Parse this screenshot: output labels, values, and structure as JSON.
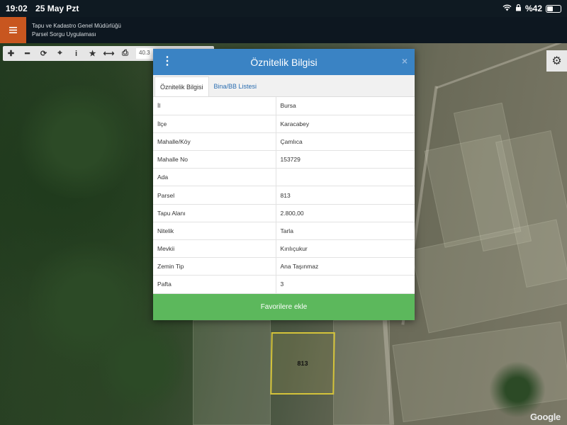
{
  "status_bar": {
    "time": "19:02",
    "date": "25 May Pzt",
    "battery": "%42"
  },
  "app": {
    "title_line1": "Tapu ve Kadastro Genel Müdürlüğü",
    "title_line2": "Parsel Sorgu Uygulaması",
    "accent_color": "#c8561f"
  },
  "toolbar": {
    "tools": [
      "plus-icon",
      "minus-icon",
      "refresh-icon",
      "locate-icon",
      "info-icon",
      "star-icon",
      "measure-icon",
      "print-icon"
    ],
    "coordinate_partial": "40.3"
  },
  "dialog": {
    "title": "Öznitelik Bilgisi",
    "close": "×",
    "tabs": [
      {
        "label": "Öznitelik Bilgisi",
        "active": true
      },
      {
        "label": "Bina/BB Listesi",
        "active": false
      }
    ],
    "rows": [
      {
        "key": "İl",
        "value": "Bursa"
      },
      {
        "key": "İlçe",
        "value": "Karacabey"
      },
      {
        "key": "Mahalle/Köy",
        "value": "Çamlıca"
      },
      {
        "key": "Mahalle No",
        "value": "153729"
      },
      {
        "key": "Ada",
        "value": ""
      },
      {
        "key": "Parsel",
        "value": "813"
      },
      {
        "key": "Tapu Alanı",
        "value": "2.800,00"
      },
      {
        "key": "Nitelik",
        "value": "Tarla"
      },
      {
        "key": "Mevkii",
        "value": "Kırılıçukur"
      },
      {
        "key": "Zemin Tip",
        "value": "Ana Taşınmaz"
      },
      {
        "key": "Pafta",
        "value": "3"
      }
    ],
    "favorite_button": "Favorilere ekle",
    "header_color": "#3a83c4",
    "button_color": "#5cb85c"
  },
  "map": {
    "parcel_label": "813",
    "attribution": "Google"
  }
}
